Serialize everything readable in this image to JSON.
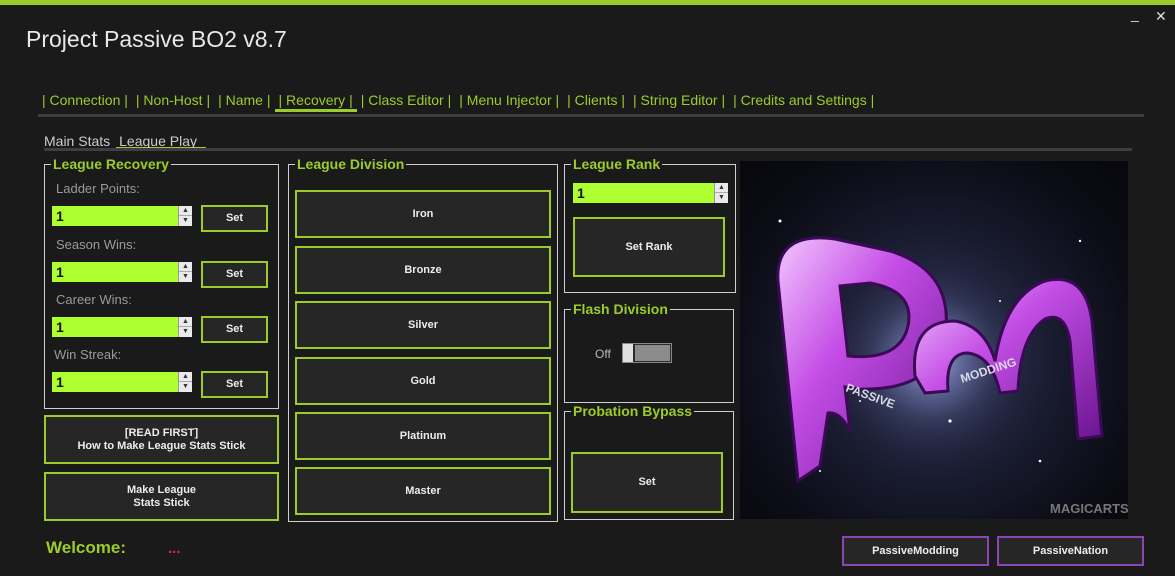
{
  "app": {
    "title": "Project Passive BO2 v8.7",
    "minimize_glyph": "_",
    "close_glyph": "✕"
  },
  "colors": {
    "accent": "#9ccc2a",
    "field": "#adff2f",
    "purple": "#8a44b4",
    "background": "#1a1a1a"
  },
  "tabs": [
    {
      "label": "Connection"
    },
    {
      "label": "Non-Host"
    },
    {
      "label": "Name"
    },
    {
      "label": "Recovery"
    },
    {
      "label": "Class Editor"
    },
    {
      "label": "Menu Injector"
    },
    {
      "label": "Clients"
    },
    {
      "label": "String Editor"
    },
    {
      "label": "Credits and Settings"
    }
  ],
  "active_tab": "Recovery",
  "subtabs": [
    {
      "label": "Main Stats"
    },
    {
      "label": "League Play"
    }
  ],
  "active_subtab": "League Play",
  "league_recovery": {
    "title": "League Recovery",
    "fields": [
      {
        "label": "Ladder Points:",
        "value": "1",
        "button": "Set"
      },
      {
        "label": "Season Wins:",
        "value": "1",
        "button": "Set"
      },
      {
        "label": "Career Wins:",
        "value": "1",
        "button": "Set"
      },
      {
        "label": "Win Streak:",
        "value": "1",
        "button": "Set"
      }
    ]
  },
  "read_first_button": "[READ FIRST]\nHow to Make League Stats Stick",
  "make_stick_button": "Make League\nStats Stick",
  "league_division": {
    "title": "League Division",
    "buttons": [
      "Iron",
      "Bronze",
      "Silver",
      "Gold",
      "Platinum",
      "Master"
    ]
  },
  "league_rank": {
    "title": "League Rank",
    "value": "1",
    "button": "Set Rank"
  },
  "flash_division": {
    "title": "Flash Division",
    "toggle_label": "Off",
    "enabled": false
  },
  "probation_bypass": {
    "title": "Probation Bypass",
    "button": "Set"
  },
  "logo": {
    "subtitle_left": "PASSIVE",
    "subtitle_right": "MODDING",
    "signature": "MAGICARTS"
  },
  "footer": {
    "welcome_label": "Welcome:",
    "username": "...",
    "buttons": [
      "PassiveModding",
      "PassiveNation"
    ]
  }
}
